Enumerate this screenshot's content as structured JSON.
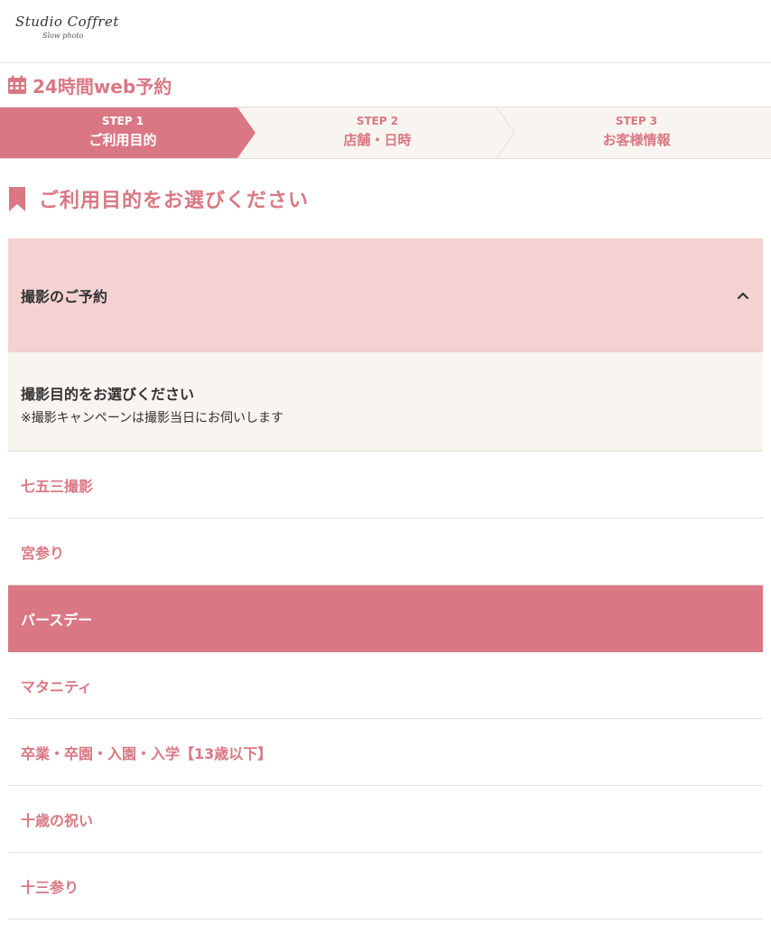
{
  "logo": {
    "main": "Studio Coffret",
    "sub": "Slow photo"
  },
  "booking": {
    "title": "24時間web予約",
    "icon": "calendar-icon"
  },
  "steps": [
    {
      "num": "STEP 1",
      "label": "ご利用目的",
      "active": true
    },
    {
      "num": "STEP 2",
      "label": "店舗・日時",
      "active": false
    },
    {
      "num": "STEP 3",
      "label": "お客様情報",
      "active": false
    }
  ],
  "section": {
    "title": "ご利用目的をお選びください",
    "icon": "bookmark-icon"
  },
  "accordion": {
    "header": "撮影のご予約",
    "info_heading": "撮影目的をお選びください",
    "info_note": "※撮影キャンペーンは撮影当日にお伺いします",
    "options": [
      {
        "label": "七五三撮影"
      },
      {
        "label": "宮参り"
      },
      {
        "label": "バースデー",
        "selected": true
      },
      {
        "label": "マタニティ"
      },
      {
        "label": "卒業・卒園・入園・入学【13歳以下】"
      },
      {
        "label": "十歳の祝い"
      },
      {
        "label": "十三参り"
      }
    ]
  },
  "colors": {
    "accent": "#d97884",
    "accent_light": "#f3d2d1",
    "beige": "#f8f4ef"
  }
}
